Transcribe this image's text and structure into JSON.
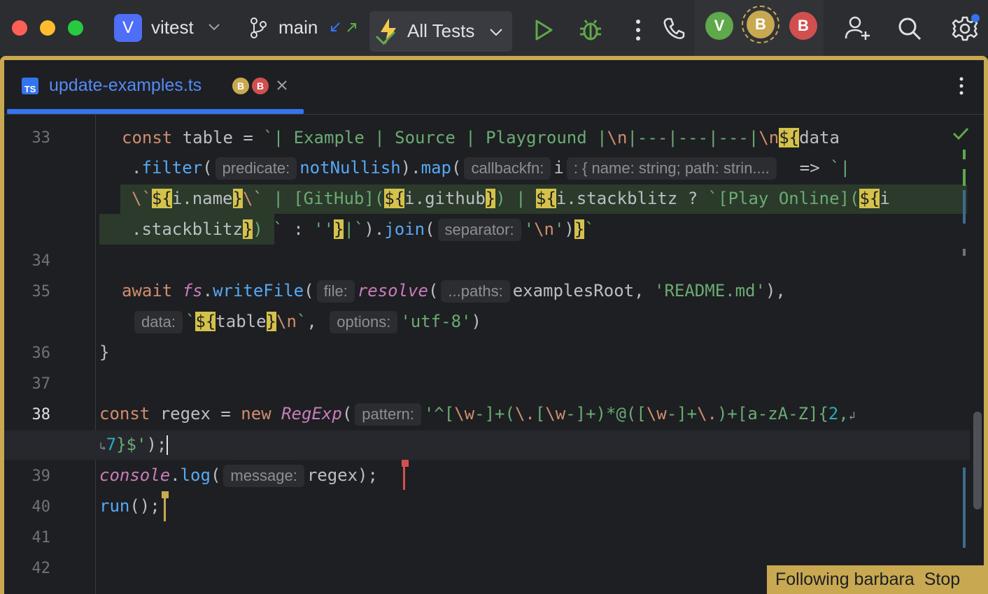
{
  "toolbar": {
    "project_icon_letter": "V",
    "project_name": "vitest",
    "branch": "main",
    "run_config": "All Tests",
    "avatars": [
      {
        "letter": "V",
        "color": "#5fa84b"
      },
      {
        "letter": "B",
        "color": "#c8a951"
      },
      {
        "letter": "B",
        "color": "#d1504f"
      }
    ]
  },
  "tab": {
    "badge": "TS",
    "filename": "update-examples.ts",
    "avatars": [
      "B",
      "B"
    ]
  },
  "gutter": {
    "lines": [
      "33",
      "34",
      "35",
      "36",
      "37",
      "38",
      "39",
      "40",
      "41",
      "42"
    ]
  },
  "inlays": {
    "predicate": "predicate:",
    "callbackfn": "callbackfn:",
    "type_hint": ": { name: string; path: strin....",
    "separator": "separator:",
    "file": "file:",
    "paths": "...paths:",
    "data": "data:",
    "options": "options:",
    "pattern": "pattern:",
    "message": "message:"
  },
  "status": {
    "following": "Following barbara",
    "stop": "Stop"
  },
  "colors": {
    "accent": "#3574f0",
    "follow_border": "#c8a951"
  }
}
